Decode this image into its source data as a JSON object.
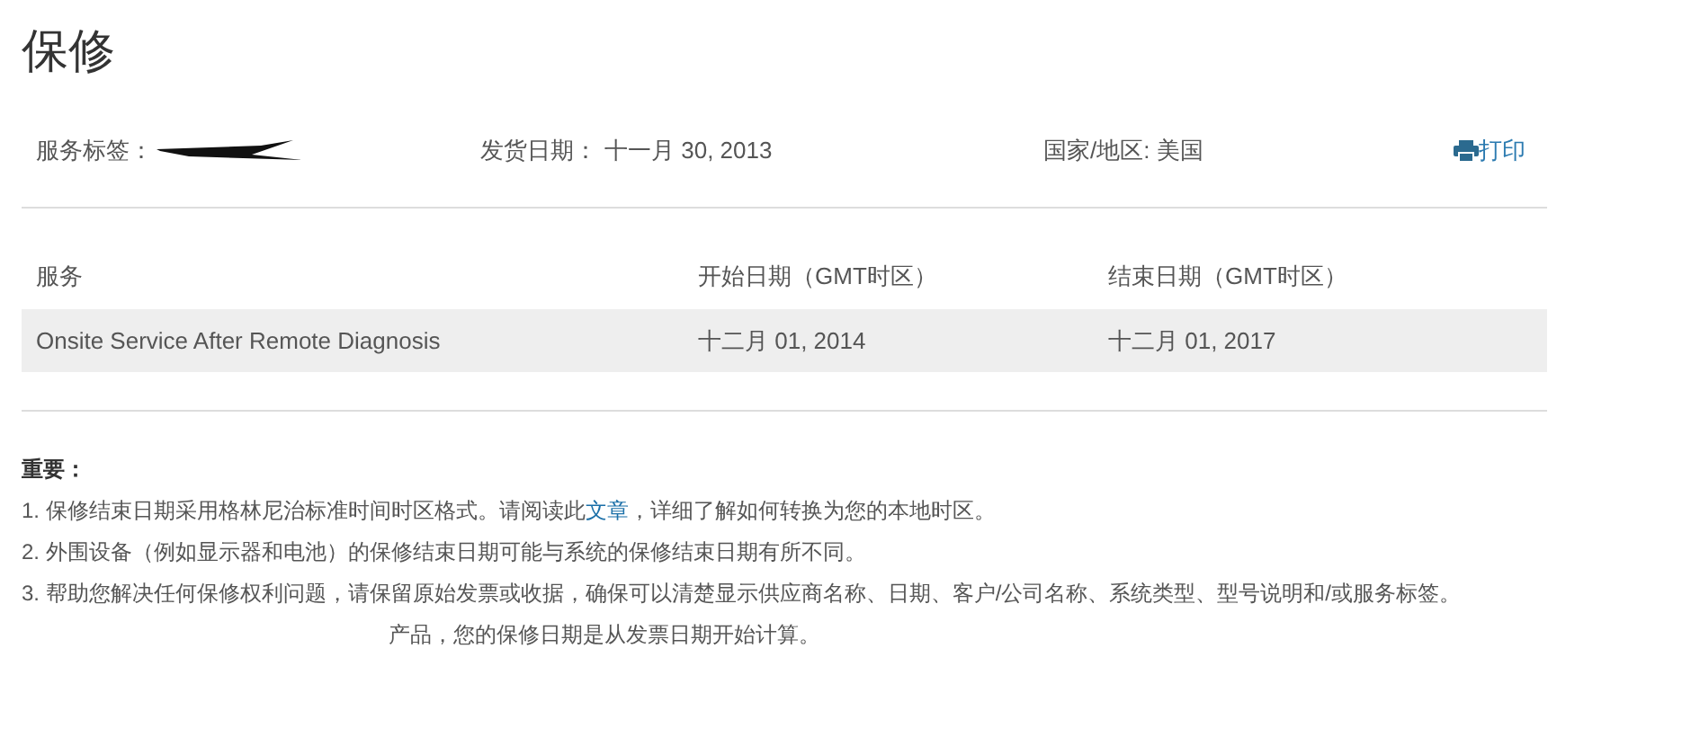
{
  "title": "保修",
  "info": [
    {
      "label": "服务标签：",
      "redacted": true
    },
    {
      "label": "发货日期：",
      "value": "十一月 30, 2013"
    },
    {
      "label": "国家/地区:",
      "value": "美国"
    }
  ],
  "print_link": "打印",
  "table": {
    "columns": [
      "服务",
      "开始日期（GMT时区）",
      "结束日期（GMT时区）"
    ],
    "rows": [
      [
        "Onsite Service After Remote Diagnosis",
        "十二月 01, 2014",
        "十二月 01, 2017"
      ]
    ]
  },
  "notes": {
    "heading": "重要：",
    "items": [
      {
        "text": "1. 保修结束日期采用格林尼治标准时间时区格式。请阅读此",
        "link": "文章",
        "after": "，详细了解如何转换为您的本地时区。"
      },
      {
        "text": "2. 外围设备（例如显示器和电池）的保修结束日期可能与系统的保修结束日期有所不同。"
      },
      {
        "text": "3. 帮助您解决任何保修权利问题，请保留原始发票或收据，确保可以清楚显示供应商名称、日期、客户/公司名称、系统类型、型号说明和/或服务标签。"
      },
      {
        "text": "产品，您的保修日期是从发票日期开始计算。",
        "partial": true
      }
    ]
  }
}
